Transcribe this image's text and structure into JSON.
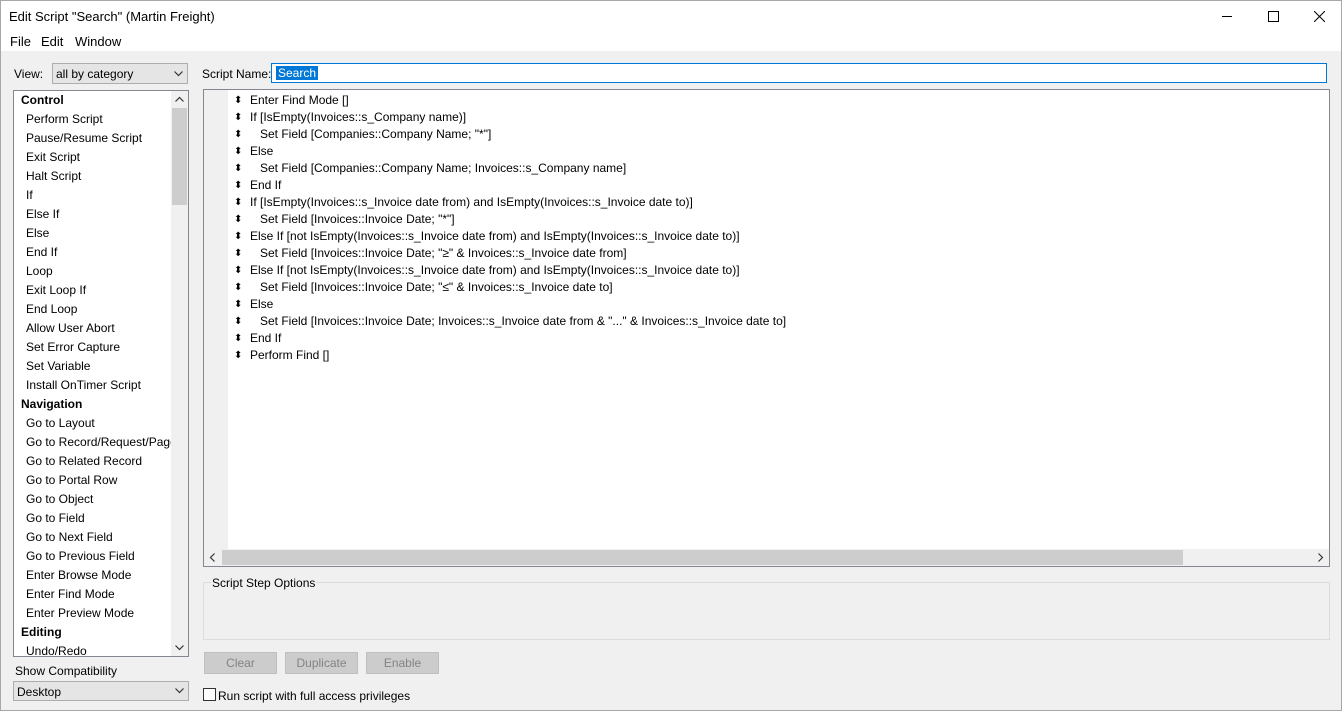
{
  "window": {
    "title": "Edit Script \"Search\" (Martin Freight)"
  },
  "menu": [
    "File",
    "Edit",
    "Window"
  ],
  "view": {
    "label": "View:",
    "selected": "all by category"
  },
  "steps": [
    {
      "type": "category",
      "label": "Control"
    },
    {
      "type": "step",
      "label": "Perform Script"
    },
    {
      "type": "step",
      "label": "Pause/Resume Script"
    },
    {
      "type": "step",
      "label": "Exit Script"
    },
    {
      "type": "step",
      "label": "Halt Script"
    },
    {
      "type": "step",
      "label": "If"
    },
    {
      "type": "step",
      "label": "Else If"
    },
    {
      "type": "step",
      "label": "Else"
    },
    {
      "type": "step",
      "label": "End If"
    },
    {
      "type": "step",
      "label": "Loop"
    },
    {
      "type": "step",
      "label": "Exit Loop If"
    },
    {
      "type": "step",
      "label": "End Loop"
    },
    {
      "type": "step",
      "label": "Allow User Abort"
    },
    {
      "type": "step",
      "label": "Set Error Capture"
    },
    {
      "type": "step",
      "label": "Set Variable"
    },
    {
      "type": "step",
      "label": "Install OnTimer Script"
    },
    {
      "type": "category",
      "label": "Navigation"
    },
    {
      "type": "step",
      "label": "Go to Layout"
    },
    {
      "type": "step",
      "label": "Go to Record/Request/Page"
    },
    {
      "type": "step",
      "label": "Go to Related Record"
    },
    {
      "type": "step",
      "label": "Go to Portal Row"
    },
    {
      "type": "step",
      "label": "Go to Object"
    },
    {
      "type": "step",
      "label": "Go to Field"
    },
    {
      "type": "step",
      "label": "Go to Next Field"
    },
    {
      "type": "step",
      "label": "Go to Previous Field"
    },
    {
      "type": "step",
      "label": "Enter Browse Mode"
    },
    {
      "type": "step",
      "label": "Enter Find Mode"
    },
    {
      "type": "step",
      "label": "Enter Preview Mode"
    },
    {
      "type": "category",
      "label": "Editing"
    },
    {
      "type": "step",
      "label": "Undo/Redo"
    }
  ],
  "compatibility": {
    "label": "Show Compatibility",
    "selected": "Desktop"
  },
  "script_name": {
    "label": "Script Name:",
    "value": "Search"
  },
  "script_lines": [
    {
      "indent": 0,
      "text": "Enter Find Mode []"
    },
    {
      "indent": 0,
      "text": "If [IsEmpty(Invoices::s_Company name)]"
    },
    {
      "indent": 1,
      "text": "Set Field [Companies::Company Name; \"*\"]"
    },
    {
      "indent": 0,
      "text": "Else"
    },
    {
      "indent": 1,
      "text": "Set Field [Companies::Company Name; Invoices::s_Company name]"
    },
    {
      "indent": 0,
      "text": "End If"
    },
    {
      "indent": 0,
      "text": "If [IsEmpty(Invoices::s_Invoice date from) and IsEmpty(Invoices::s_Invoice date to)]"
    },
    {
      "indent": 1,
      "text": "Set Field [Invoices::Invoice Date; \"*\"]"
    },
    {
      "indent": 0,
      "text": "Else If [not IsEmpty(Invoices::s_Invoice date from) and IsEmpty(Invoices::s_Invoice date to)]"
    },
    {
      "indent": 1,
      "text": "Set Field [Invoices::Invoice Date; \"≥\" & Invoices::s_Invoice date from]"
    },
    {
      "indent": 0,
      "text": "Else If [not IsEmpty(Invoices::s_Invoice date from) and IsEmpty(Invoices::s_Invoice date to)]"
    },
    {
      "indent": 1,
      "text": "Set Field [Invoices::Invoice Date; \"≤\" & Invoices::s_Invoice date to]"
    },
    {
      "indent": 0,
      "text": "Else"
    },
    {
      "indent": 1,
      "text": "Set Field [Invoices::Invoice Date; Invoices::s_Invoice date from & \"...\" & Invoices::s_Invoice date to]"
    },
    {
      "indent": 0,
      "text": "End If"
    },
    {
      "indent": 0,
      "text": "Perform Find []"
    }
  ],
  "options": {
    "title": "Script Step Options"
  },
  "buttons": {
    "clear": "Clear",
    "duplicate": "Duplicate",
    "enable": "Enable"
  },
  "run_full_access": {
    "label": "Run script with full access privileges",
    "checked": false
  },
  "icons": {
    "minimize": "minimize-icon",
    "maximize": "maximize-icon",
    "close": "close-icon",
    "drag_handle": "drag-handle-icon"
  }
}
